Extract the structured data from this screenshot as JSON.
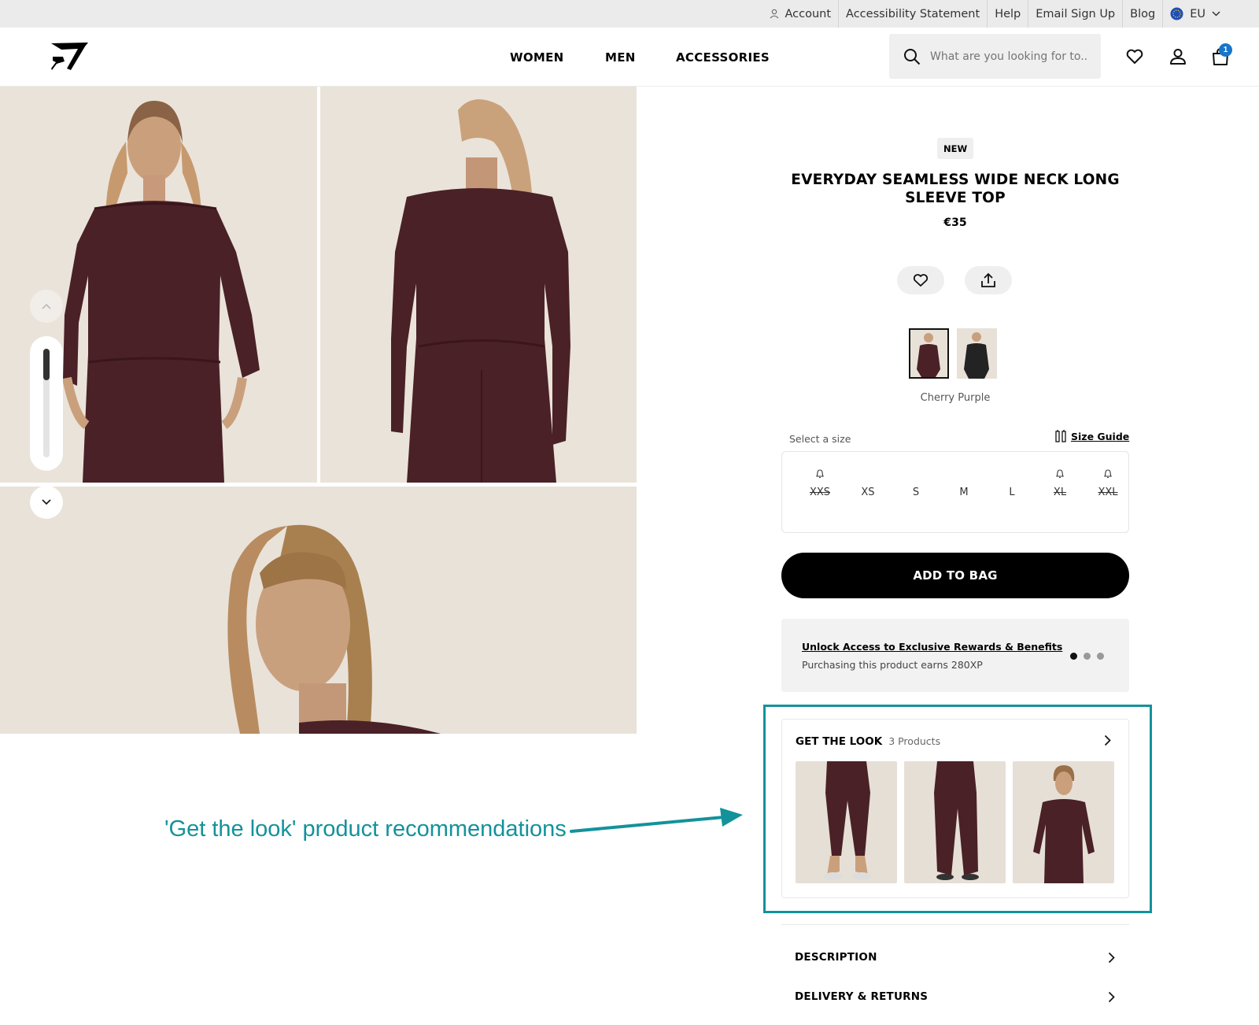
{
  "util_bar": {
    "account": "Account",
    "accessibility": "Accessibility Statement",
    "help": "Help",
    "email_signup": "Email Sign Up",
    "blog": "Blog",
    "region": "EU"
  },
  "nav": {
    "women": "WOMEN",
    "men": "MEN",
    "accessories": "ACCESSORIES"
  },
  "search": {
    "placeholder": "What are you looking for to..."
  },
  "cart": {
    "count": "1"
  },
  "product": {
    "tag": "NEW",
    "title": "EVERYDAY SEAMLESS WIDE NECK LONG SLEEVE TOP",
    "price": "€35",
    "colour": "Cherry Purple"
  },
  "sizes": {
    "label": "Select a size",
    "guide": "Size Guide",
    "options": [
      {
        "label": "XXS",
        "available": false
      },
      {
        "label": "XS",
        "available": true
      },
      {
        "label": "S",
        "available": true
      },
      {
        "label": "M",
        "available": true
      },
      {
        "label": "L",
        "available": true
      },
      {
        "label": "XL",
        "available": false
      },
      {
        "label": "XXL",
        "available": false
      }
    ]
  },
  "add_to_bag": "ADD TO BAG",
  "rewards": {
    "link": "Unlock Access to Exclusive Rewards & Benefits",
    "text": "Purchasing this product earns 280XP"
  },
  "get_the_look": {
    "title": "GET THE LOOK",
    "count": "3 Products"
  },
  "accordion": {
    "description": "DESCRIPTION",
    "delivery": "DELIVERY & RETURNS"
  },
  "annotation": "'Get the look' product recommendations",
  "icons": [
    "user-icon",
    "globe-icon",
    "chevron-down-icon",
    "logo-icon",
    "search-icon",
    "heart-icon",
    "account-icon",
    "bag-icon",
    "chevron-up-icon",
    "share-icon",
    "bell-icon",
    "ruler-icon",
    "chevron-right-icon",
    "arrow-icon"
  ],
  "colors": {
    "accent": "#13929b",
    "badge": "#1875c9",
    "product": "#4a2127",
    "photo_bg": "#e9e2d9"
  }
}
